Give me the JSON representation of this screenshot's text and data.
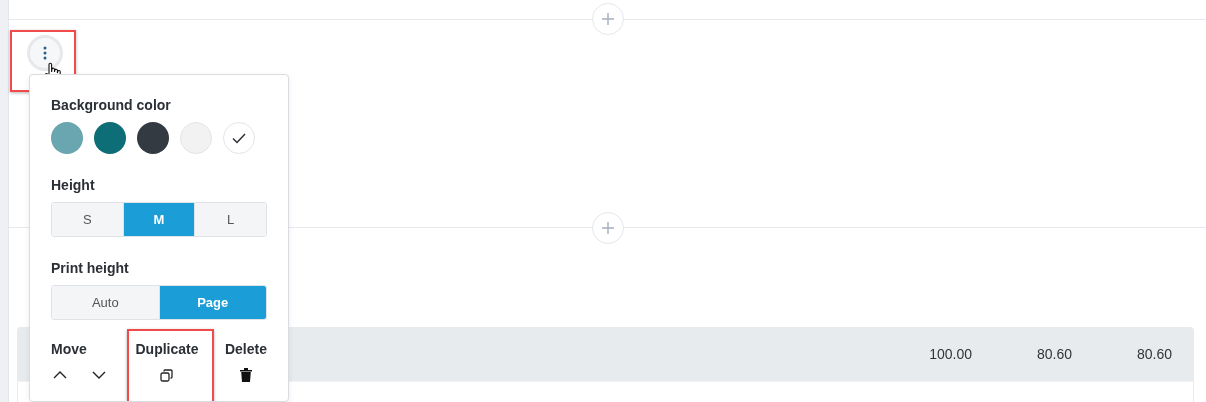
{
  "menu_button": {
    "highlighted": true
  },
  "popover": {
    "background_color": {
      "title": "Background color",
      "swatches": [
        {
          "color": "#6aa6b0",
          "selected": false
        },
        {
          "color": "#0e6e78",
          "selected": false
        },
        {
          "color": "#343a42",
          "selected": false
        },
        {
          "color": "#f2f2f2",
          "selected": false
        },
        {
          "color": "#ffffff",
          "selected": true
        }
      ]
    },
    "height": {
      "title": "Height",
      "options": [
        {
          "label": "S",
          "selected": false
        },
        {
          "label": "M",
          "selected": true
        },
        {
          "label": "L",
          "selected": false
        }
      ]
    },
    "print_height": {
      "title": "Print height",
      "options": [
        {
          "label": "Auto",
          "selected": false
        },
        {
          "label": "Page",
          "selected": true
        }
      ]
    },
    "actions": [
      {
        "kind": "move",
        "label": "Move",
        "highlighted": false
      },
      {
        "kind": "duplicate",
        "label": "Duplicate",
        "highlighted": true
      },
      {
        "kind": "delete",
        "label": "Delete",
        "highlighted": false
      }
    ]
  },
  "table": {
    "header_values": [
      "100.00",
      "80.60",
      "80.60"
    ]
  }
}
